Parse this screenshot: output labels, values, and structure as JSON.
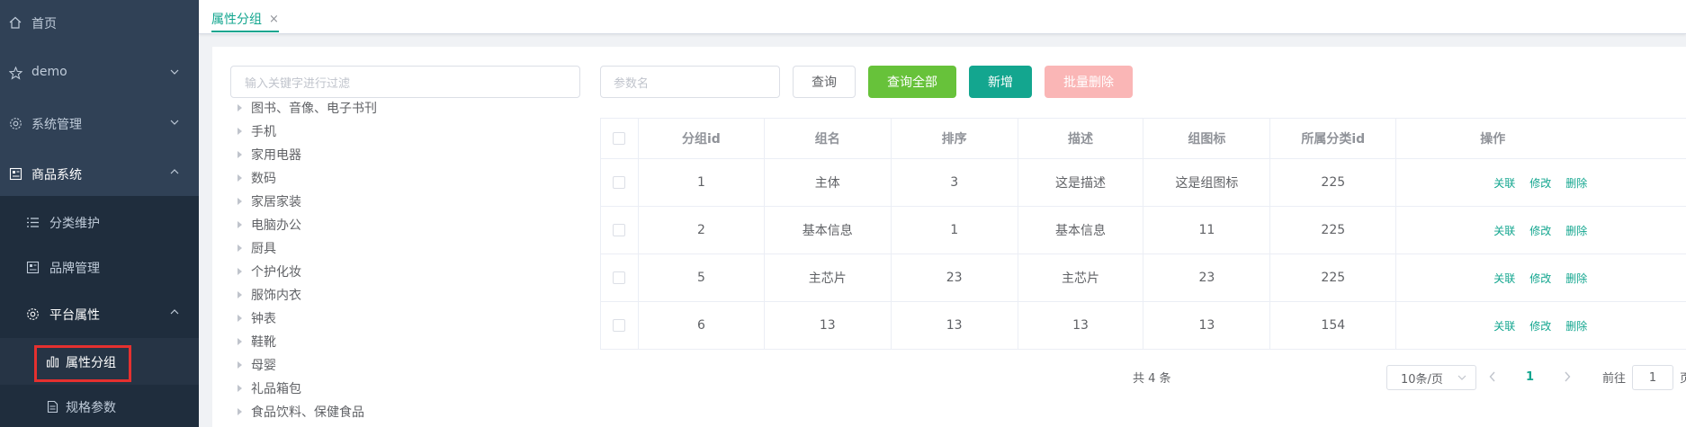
{
  "sidebar": {
    "items": [
      {
        "label": "首页"
      },
      {
        "label": "demo"
      },
      {
        "label": "系统管理"
      },
      {
        "label": "商品系统"
      },
      {
        "label": "分类维护"
      },
      {
        "label": "品牌管理"
      },
      {
        "label": "平台属性"
      },
      {
        "label": "属性分组"
      },
      {
        "label": "规格参数"
      }
    ]
  },
  "tags": {
    "active": "属性分组",
    "close": "×"
  },
  "tree": {
    "filter_placeholder": "输入关键字进行过滤",
    "nodes": [
      "图书、音像、电子书刊",
      "手机",
      "家用电器",
      "数码",
      "家居家装",
      "电脑办公",
      "厨具",
      "个护化妆",
      "服饰内衣",
      "钟表",
      "鞋靴",
      "母婴",
      "礼品箱包",
      "食品饮料、保健食品"
    ]
  },
  "toolbar": {
    "param_placeholder": "参数名",
    "query": "查询",
    "query_all": "查询全部",
    "add": "新增",
    "batch_delete": "批量删除"
  },
  "table": {
    "columns": [
      "分组id",
      "组名",
      "排序",
      "描述",
      "组图标",
      "所属分类id",
      "操作"
    ],
    "rows": [
      {
        "id": "1",
        "name": "主体",
        "sort": "3",
        "desc": "这是描述",
        "icon": "这是组图标",
        "catelog": "225"
      },
      {
        "id": "2",
        "name": "基本信息",
        "sort": "1",
        "desc": "基本信息",
        "icon": "11",
        "catelog": "225"
      },
      {
        "id": "5",
        "name": "主芯片",
        "sort": "23",
        "desc": "主芯片",
        "icon": "23",
        "catelog": "225"
      },
      {
        "id": "6",
        "name": "13",
        "sort": "13",
        "desc": "13",
        "icon": "13",
        "catelog": "154"
      }
    ],
    "ops": {
      "relate": "关联",
      "edit": "修改",
      "delete": "删除"
    }
  },
  "pagination": {
    "total": "共 4 条",
    "page_size": "10条/页",
    "current": "1",
    "goto_prefix": "前往",
    "goto_value": "1",
    "goto_suffix": "页"
  },
  "colors": {
    "accent": "#13a68f",
    "success": "#67c23a",
    "danger_light": "#fab6b6",
    "sidebar": "#304156",
    "highlight": "#e5302f"
  }
}
